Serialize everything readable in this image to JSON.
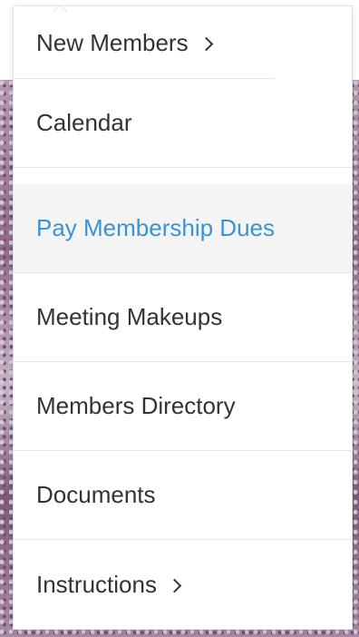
{
  "menu": {
    "items": [
      {
        "label": "New Members",
        "has_submenu": true,
        "active": false
      },
      {
        "label": "Calendar",
        "has_submenu": false,
        "active": false
      },
      {
        "label": "Pay Membership Dues",
        "has_submenu": false,
        "active": true
      },
      {
        "label": "Meeting Makeups",
        "has_submenu": false,
        "active": false
      },
      {
        "label": "Members Directory",
        "has_submenu": false,
        "active": false
      },
      {
        "label": "Documents",
        "has_submenu": false,
        "active": false
      },
      {
        "label": "Instructions",
        "has_submenu": true,
        "active": false
      }
    ]
  },
  "colors": {
    "text": "#333333",
    "active_text": "#3a94d3",
    "active_background": "#f4f4f4",
    "divider": "#e5e5e5"
  },
  "icons": {
    "submenu": "chevron-right-icon"
  }
}
